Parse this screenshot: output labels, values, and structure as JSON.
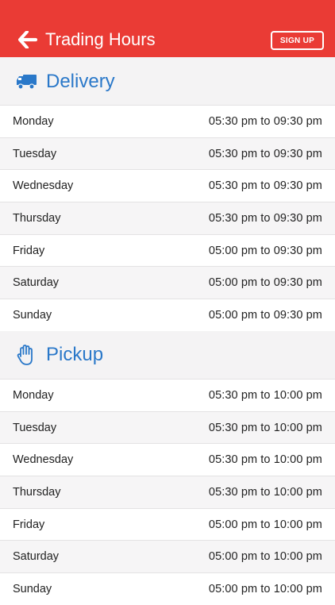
{
  "header": {
    "title": "Trading Hours",
    "signup_label": "SIGN UP",
    "back_icon": "arrow-left-icon",
    "color": "#ea3b35"
  },
  "delivery": {
    "title": "Delivery",
    "icon": "truck-icon",
    "rows": [
      {
        "day": "Monday",
        "hours": "05:30 pm to 09:30 pm"
      },
      {
        "day": "Tuesday",
        "hours": "05:30 pm to 09:30 pm"
      },
      {
        "day": "Wednesday",
        "hours": "05:30 pm to 09:30 pm"
      },
      {
        "day": "Thursday",
        "hours": "05:30 pm to 09:30 pm"
      },
      {
        "day": "Friday",
        "hours": "05:00 pm to 09:30 pm"
      },
      {
        "day": "Saturday",
        "hours": "05:00 pm to 09:30 pm"
      },
      {
        "day": "Sunday",
        "hours": "05:00 pm to 09:30 pm"
      }
    ]
  },
  "pickup": {
    "title": "Pickup",
    "icon": "hand-icon",
    "rows": [
      {
        "day": "Monday",
        "hours": "05:30 pm to 10:00 pm"
      },
      {
        "day": "Tuesday",
        "hours": "05:30 pm to 10:00 pm"
      },
      {
        "day": "Wednesday",
        "hours": "05:30 pm to 10:00 pm"
      },
      {
        "day": "Thursday",
        "hours": "05:30 pm to 10:00 pm"
      },
      {
        "day": "Friday",
        "hours": "05:00 pm to 10:00 pm"
      },
      {
        "day": "Saturday",
        "hours": "05:00 pm to 10:00 pm"
      },
      {
        "day": "Sunday",
        "hours": "05:00 pm to 10:00 pm"
      }
    ]
  },
  "accent_color": "#2a78c9"
}
